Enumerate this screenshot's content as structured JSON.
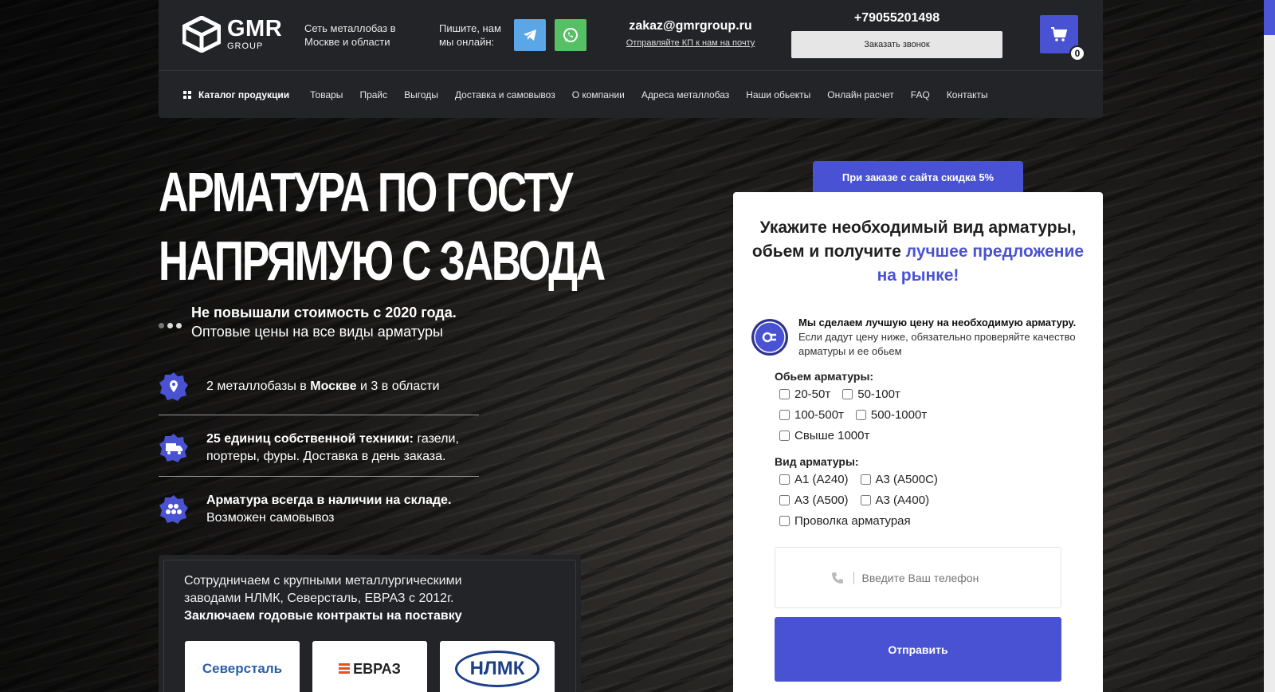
{
  "header": {
    "logo_name": "GMR",
    "logo_sub": "GROUP",
    "tagline": "Сеть металлобаз в Москве и области",
    "write_us": "Пишите, нам мы онлайн:",
    "email": "zakaz@gmrgroup.ru",
    "email_sub": "Отправляйте КП к нам на почту",
    "phone": "+79055201498",
    "callback_label": "Заказать звонок",
    "cart_count": "0"
  },
  "nav": {
    "catalog": "Каталог продукции",
    "items": [
      "Товары",
      "Прайс",
      "Выгоды",
      "Доставка и самовывоз",
      "О компании",
      "Адреса металлобаз",
      "Наши обьекты",
      "Онлайн расчет",
      "FAQ",
      "Контакты"
    ]
  },
  "hero": {
    "title_line1": "АРМАТУРА ПО ГОСТУ",
    "title_line2": "НАПРЯМУЮ С ЗАВОДА",
    "feat1_bold": "Не повышали стоимость с 2020 года.",
    "feat1_rest": "Оптовые цены на все виды арматуры",
    "feat2_a": "2 металлобазы в ",
    "feat2_b": "Москве",
    "feat2_c": " и 3 в области",
    "feat3_bold": "25 единиц собственной техники:",
    "feat3_rest": " газели, портеры, фуры. Доставка в день заказа.",
    "feat4_bold": "Арматура всегда в наличии на складе.",
    "feat4_rest": "Возможен самовывоз"
  },
  "partners": {
    "text": "Сотрудничаем с крупными металлургическими заводами НЛМК, Северсталь, ЕВРАЗ с 2012г.",
    "bold": "Заключаем годовые контракты на поставку",
    "logos": [
      "Северсталь",
      "ЕВРАЗ",
      "НЛМК"
    ]
  },
  "form": {
    "discount": "При заказе с сайта скидка 5%",
    "title_plain": "Укажите необходимый вид арматуры, обьем и получите ",
    "title_accent": "лучшее предложение на рынке!",
    "promise_bold": "Мы сделаем лучшую цену на необходимую арматуру.",
    "promise_rest": " Если дадут цену ниже, обязательно проверяйте качество арматуры и ее обьем",
    "volume_label": "Обьем арматуры:",
    "volume_options": [
      "20-50т",
      "50-100т",
      "100-500т",
      "500-1000т",
      "Свыше 1000т"
    ],
    "type_label": "Вид арматуры:",
    "type_options": [
      "А1 (А240)",
      "А3 (А500С)",
      "А3 (А500)",
      "А3 (А400)",
      "Проволка арматурая"
    ],
    "phone_placeholder": "Введите Ваш телефон",
    "submit_label": "Отправить"
  },
  "colors": {
    "accent": "#4a52d4",
    "header_bg": "#232428",
    "telegram": "#5aa6e6",
    "whatsapp": "#56c064"
  }
}
